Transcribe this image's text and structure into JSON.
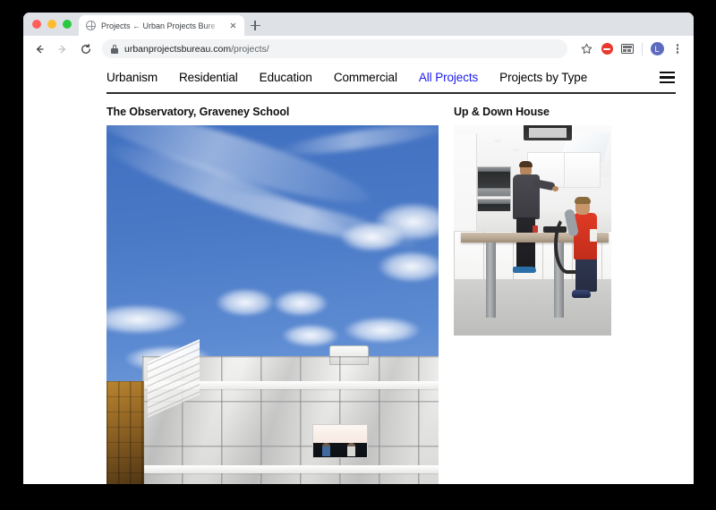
{
  "browser": {
    "traffic_lights": [
      "close",
      "minimize",
      "maximize"
    ],
    "tab": {
      "title": "Projects ← Urban Projects Bure",
      "favicon": "globe-icon",
      "close_icon": "close-icon"
    },
    "new_tab_label": "+",
    "toolbar": {
      "back_icon": "back-arrow-icon",
      "forward_icon": "forward-arrow-icon",
      "reload_icon": "reload-icon",
      "lock_icon": "lock-icon",
      "url_domain": "urbanprojectsbureau.com",
      "url_path": "/projects/",
      "bookmark_icon": "star-icon",
      "extension_red_icon": "extension-blocker-icon",
      "extension_grey_icon": "extension-toolbar-icon",
      "profile_initial": "L",
      "menu_icon": "kebab-menu-icon"
    }
  },
  "site": {
    "nav": {
      "items": [
        {
          "label": "Urbanism",
          "active": false
        },
        {
          "label": "Residential",
          "active": false
        },
        {
          "label": "Education",
          "active": false
        },
        {
          "label": "Commercial",
          "active": false
        },
        {
          "label": "All Projects",
          "active": true
        },
        {
          "label": "Projects by Type",
          "active": false
        }
      ],
      "menu_icon": "hamburger-menu-icon",
      "active_color": "#1b1bee"
    },
    "projects": [
      {
        "title": "The Observatory, Graveney School",
        "image_alt": "white-modernist-school-building-under-blue-sky"
      },
      {
        "title": "Up & Down House",
        "image_alt": "modern-white-kitchen-with-adjustable-height-island"
      }
    ]
  }
}
